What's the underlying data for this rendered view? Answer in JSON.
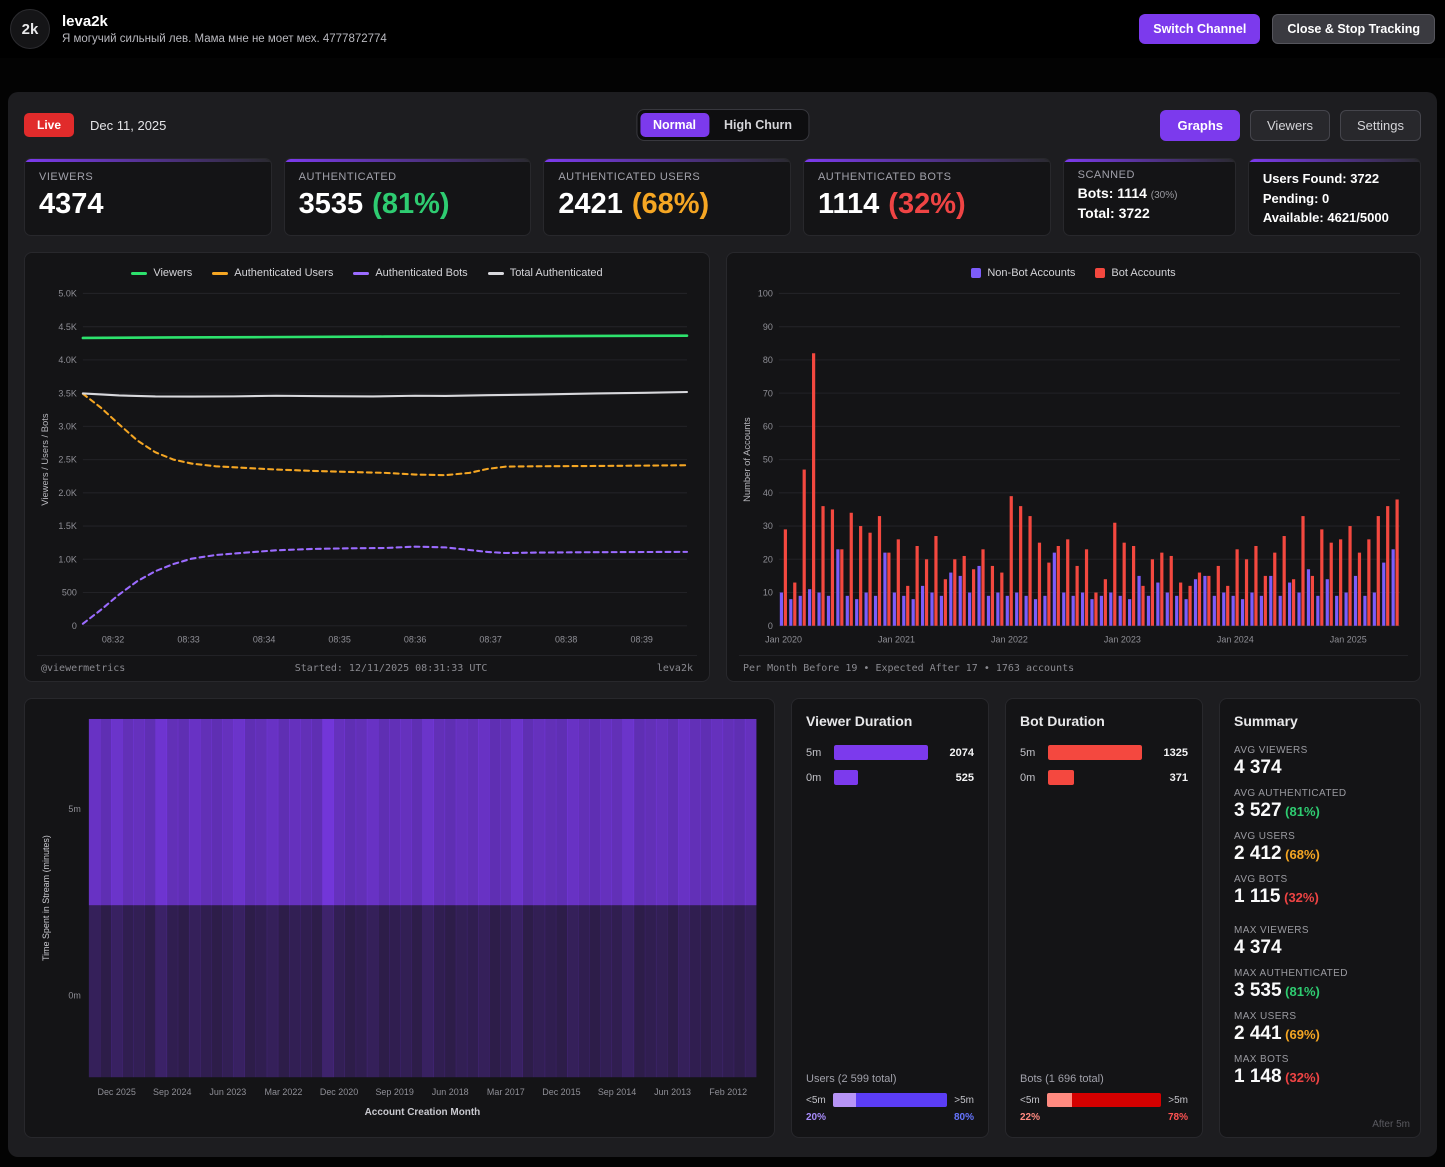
{
  "header": {
    "logo": "2k",
    "channel": "leva2k",
    "subtitle": "Я могучий сильный лев. Мама мне не моет мех. 4777872774",
    "switch_channel_label": "Switch Channel",
    "close_stop_label": "Close & Stop Tracking"
  },
  "toolbar": {
    "live_label": "Live",
    "date": "Dec 11, 2025",
    "mode_normal": "Normal",
    "mode_high_churn": "High Churn",
    "graphs_label": "Graphs",
    "viewers_label": "Viewers",
    "settings_label": "Settings"
  },
  "stats": [
    {
      "label": "VIEWERS",
      "value": "4374",
      "percent": "",
      "color": "#ffffff"
    },
    {
      "label": "AUTHENTICATED",
      "value": "3535",
      "percent": "(81%)",
      "color": "#2ecc71"
    },
    {
      "label": "AUTHENTICATED USERS",
      "value": "2421",
      "percent": "(68%)",
      "color": "#f5a623"
    },
    {
      "label": "AUTHENTICATED BOTS",
      "value": "1114",
      "percent": "(32%)",
      "color": "#ef4444"
    }
  ],
  "scanned": {
    "title": "SCANNED",
    "bots_line": "Bots: 1114",
    "bots_pct": "(30%)",
    "total_line": "Total: 3722"
  },
  "found": {
    "line1": "Users Found: 3722",
    "line2": "Pending: 0",
    "line3": "Available: 4621/5000"
  },
  "chart_data": [
    {
      "type": "line",
      "ylabel": "Viewers / Users / Bots",
      "ylim": [
        0,
        5000
      ],
      "ytick_step": 500,
      "yticks": [
        "0",
        "500",
        "1.0K",
        "1.5K",
        "2.0K",
        "2.5K",
        "3.0K",
        "3.5K",
        "4.0K",
        "4.5K",
        "5.0K"
      ],
      "xticks": [
        "08:32",
        "08:33",
        "08:34",
        "08:35",
        "08:36",
        "08:37",
        "08:38",
        "08:39"
      ],
      "xtick_start": 0.05,
      "xtick_step": 0.125,
      "series": [
        {
          "name": "Viewers",
          "color": "#2de26d",
          "dashed": false,
          "width": 2.5,
          "points": [
            [
              0,
              4330
            ],
            [
              0.15,
              4338
            ],
            [
              0.3,
              4342
            ],
            [
              0.5,
              4350
            ],
            [
              0.7,
              4355
            ],
            [
              0.85,
              4360
            ],
            [
              1,
              4365
            ]
          ]
        },
        {
          "name": "Authenticated Users",
          "color": "#f5a623",
          "dashed": true,
          "width": 2,
          "points": [
            [
              0,
              3490
            ],
            [
              0.03,
              3280
            ],
            [
              0.06,
              3030
            ],
            [
              0.09,
              2790
            ],
            [
              0.12,
              2610
            ],
            [
              0.15,
              2500
            ],
            [
              0.18,
              2440
            ],
            [
              0.22,
              2400
            ],
            [
              0.27,
              2375
            ],
            [
              0.32,
              2350
            ],
            [
              0.38,
              2330
            ],
            [
              0.44,
              2315
            ],
            [
              0.5,
              2300
            ],
            [
              0.55,
              2275
            ],
            [
              0.6,
              2265
            ],
            [
              0.64,
              2300
            ],
            [
              0.67,
              2360
            ],
            [
              0.7,
              2395
            ],
            [
              0.75,
              2400
            ],
            [
              0.82,
              2403
            ],
            [
              0.9,
              2408
            ],
            [
              1,
              2415
            ]
          ]
        },
        {
          "name": "Authenticated Bots",
          "color": "#9b6bff",
          "dashed": true,
          "width": 2,
          "points": [
            [
              0,
              30
            ],
            [
              0.03,
              240
            ],
            [
              0.06,
              470
            ],
            [
              0.09,
              670
            ],
            [
              0.12,
              820
            ],
            [
              0.15,
              930
            ],
            [
              0.18,
              1010
            ],
            [
              0.22,
              1065
            ],
            [
              0.27,
              1100
            ],
            [
              0.32,
              1135
            ],
            [
              0.38,
              1155
            ],
            [
              0.44,
              1165
            ],
            [
              0.5,
              1170
            ],
            [
              0.55,
              1190
            ],
            [
              0.6,
              1180
            ],
            [
              0.64,
              1140
            ],
            [
              0.67,
              1110
            ],
            [
              0.7,
              1095
            ],
            [
              0.75,
              1100
            ],
            [
              0.82,
              1105
            ],
            [
              0.9,
              1108
            ],
            [
              1,
              1112
            ]
          ]
        },
        {
          "name": "Total Authenticated",
          "color": "#d8d8dc",
          "dashed": false,
          "width": 2,
          "points": [
            [
              0,
              3495
            ],
            [
              0.06,
              3465
            ],
            [
              0.12,
              3450
            ],
            [
              0.18,
              3448
            ],
            [
              0.25,
              3452
            ],
            [
              0.32,
              3460
            ],
            [
              0.4,
              3455
            ],
            [
              0.48,
              3450
            ],
            [
              0.55,
              3460
            ],
            [
              0.6,
              3458
            ],
            [
              0.67,
              3468
            ],
            [
              0.75,
              3478
            ],
            [
              0.85,
              3495
            ],
            [
              0.93,
              3505
            ],
            [
              1,
              3518
            ]
          ]
        }
      ],
      "footer_left": "@viewermetrics",
      "footer_center": "Started: 12/11/2025 08:31:33 UTC",
      "footer_right": "leva2k"
    },
    {
      "type": "bar",
      "ylabel": "Number of Accounts",
      "ylim": [
        0,
        100
      ],
      "yticks": [
        "0",
        "10",
        "20",
        "30",
        "40",
        "50",
        "60",
        "70",
        "80",
        "90",
        "100"
      ],
      "xticks": [
        "Jan 2020",
        "Jan 2021",
        "Jan 2022",
        "Jan 2023",
        "Jan 2024",
        "Jan 2025"
      ],
      "xtick_indices": [
        0,
        12,
        24,
        36,
        48,
        60
      ],
      "legend": [
        {
          "name": "Non-Bot Accounts",
          "color": "#7c5cfa"
        },
        {
          "name": "Bot Accounts",
          "color": "#f4483f"
        }
      ],
      "nonbot": [
        10,
        8,
        9,
        11,
        10,
        9,
        23,
        9,
        8,
        10,
        9,
        22,
        10,
        9,
        8,
        12,
        10,
        9,
        16,
        15,
        10,
        18,
        9,
        10,
        9,
        10,
        9,
        8,
        9,
        22,
        10,
        9,
        10,
        8,
        9,
        10,
        9,
        8,
        15,
        9,
        13,
        10,
        9,
        8,
        14,
        15,
        9,
        10,
        9,
        8,
        10,
        9,
        15,
        9,
        13,
        10,
        17,
        9,
        14,
        9,
        10,
        15,
        9,
        10,
        19,
        23
      ],
      "bot": [
        29,
        13,
        47,
        82,
        36,
        35,
        23,
        34,
        30,
        28,
        33,
        22,
        26,
        12,
        24,
        20,
        27,
        14,
        20,
        21,
        17,
        23,
        18,
        16,
        39,
        36,
        33,
        25,
        19,
        24,
        26,
        18,
        23,
        10,
        14,
        31,
        25,
        24,
        12,
        20,
        22,
        21,
        13,
        12,
        16,
        15,
        18,
        12,
        23,
        20,
        24,
        15,
        22,
        27,
        14,
        33,
        15,
        29,
        25,
        26,
        30,
        22,
        26,
        33,
        36,
        38
      ],
      "footer": "Per Month Before 19 • Expected After 17 • 1763 accounts"
    },
    {
      "type": "heatmap",
      "ylabel": "Time Spent in Stream (minutes)",
      "xlabel": "Account Creation Month",
      "yticks": [
        "5m",
        "0m"
      ],
      "xticks": [
        "Dec 2025",
        "Sep 2024",
        "Jun 2023",
        "Mar 2022",
        "Dec 2020",
        "Sep 2019",
        "Jun 2018",
        "Mar 2017",
        "Dec 2015",
        "Sep 2014",
        "Jun 2013",
        "Feb 2012"
      ],
      "color": "#7c3aed",
      "top": [
        0.85,
        0.7,
        0.9,
        0.75,
        0.8,
        0.7,
        0.95,
        0.75,
        0.7,
        0.85,
        0.75,
        0.7,
        0.8,
        0.9,
        0.7,
        0.75,
        0.85,
        0.7,
        0.8,
        0.75,
        0.7,
        1.0,
        0.8,
        0.7,
        0.75,
        0.85,
        0.7,
        0.75,
        0.8,
        0.7,
        0.9,
        0.75,
        0.7,
        0.8,
        0.75,
        0.85,
        0.7,
        0.75,
        0.9,
        0.7,
        0.8,
        0.75,
        0.7,
        0.85,
        0.75,
        0.7,
        0.8,
        0.75,
        0.9,
        0.7,
        0.75,
        0.8,
        0.7,
        0.85,
        0.75,
        0.7,
        0.8,
        0.75,
        0.7,
        0.8
      ],
      "bottom": [
        0.4,
        0.25,
        0.45,
        0.3,
        0.35,
        0.25,
        0.5,
        0.3,
        0.25,
        0.4,
        0.3,
        0.25,
        0.35,
        0.45,
        0.25,
        0.3,
        0.4,
        0.25,
        0.35,
        0.3,
        0.25,
        0.55,
        0.35,
        0.25,
        0.3,
        0.4,
        0.25,
        0.3,
        0.35,
        0.25,
        0.45,
        0.3,
        0.25,
        0.35,
        0.3,
        0.4,
        0.25,
        0.3,
        0.45,
        0.25,
        0.35,
        0.3,
        0.25,
        0.4,
        0.3,
        0.25,
        0.35,
        0.3,
        0.45,
        0.25,
        0.3,
        0.35,
        0.25,
        0.4,
        0.3,
        0.25,
        0.35,
        0.3,
        0.25,
        0.35
      ]
    }
  ],
  "viewer_duration": {
    "title": "Viewer Duration",
    "rows": [
      {
        "label": "5m",
        "value": "2074"
      },
      {
        "label": "0m",
        "value": "525"
      }
    ],
    "bar_color": "#7c3aed",
    "total_label": "Users (2 599 total)",
    "left_label": "<5m",
    "right_label": ">5m",
    "left_pct": "20%",
    "right_pct": "80%",
    "left_color": "#b794f6",
    "right_color": "#5b3df5",
    "left_pct_color": "#a78bfa",
    "right_pct_color": "#6675ff"
  },
  "bot_duration": {
    "title": "Bot Duration",
    "rows": [
      {
        "label": "5m",
        "value": "1325"
      },
      {
        "label": "0m",
        "value": "371"
      }
    ],
    "bar_color": "#f4483f",
    "total_label": "Bots (1 696 total)",
    "left_label": "<5m",
    "right_label": ">5m",
    "left_pct": "22%",
    "right_pct": "78%",
    "left_color": "#ff8a80",
    "right_color": "#d50000",
    "left_pct_color": "#ff8a80",
    "right_pct_color": "#ff5252"
  },
  "summary": {
    "title": "Summary",
    "footnote": "After 5m",
    "items": [
      {
        "label": "AVG VIEWERS",
        "value": "4 374",
        "percent": "",
        "color": ""
      },
      {
        "label": "AVG AUTHENTICATED",
        "value": "3 527",
        "percent": "(81%)",
        "color": "#2ecc71"
      },
      {
        "label": "AVG USERS",
        "value": "2 412",
        "percent": "(68%)",
        "color": "#f5a623"
      },
      {
        "label": "AVG BOTS",
        "value": "1 115",
        "percent": "(32%)",
        "color": "#ef4444"
      },
      {
        "label": "MAX VIEWERS",
        "value": "4 374",
        "percent": "",
        "color": ""
      },
      {
        "label": "MAX AUTHENTICATED",
        "value": "3 535",
        "percent": "(81%)",
        "color": "#2ecc71"
      },
      {
        "label": "MAX USERS",
        "value": "2 441",
        "percent": "(69%)",
        "color": "#f5a623"
      },
      {
        "label": "MAX BOTS",
        "value": "1 148",
        "percent": "(32%)",
        "color": "#ef4444"
      }
    ]
  }
}
